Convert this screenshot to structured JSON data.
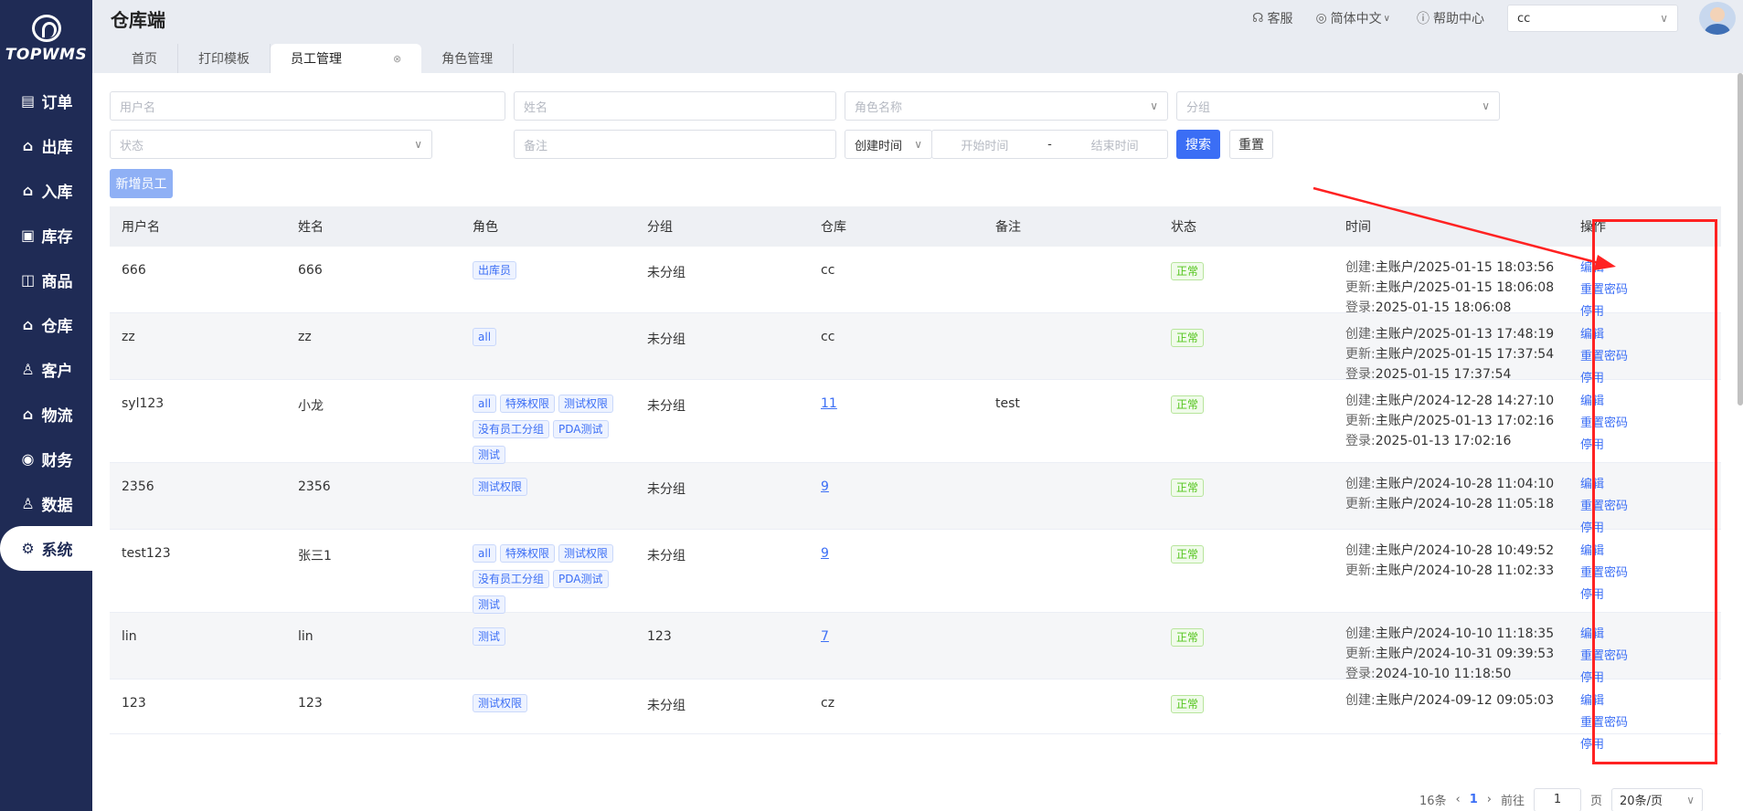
{
  "app": {
    "logo_text": "TOPWMS",
    "page_title": "仓库端"
  },
  "sidebar": {
    "items": [
      {
        "label": "订单",
        "icon": "list-icon",
        "glyph": "▤"
      },
      {
        "label": "出库",
        "icon": "outbound-icon",
        "glyph": "⌂"
      },
      {
        "label": "入库",
        "icon": "inbound-icon",
        "glyph": "⌂"
      },
      {
        "label": "库存",
        "icon": "inventory-icon",
        "glyph": "▣"
      },
      {
        "label": "商品",
        "icon": "goods-icon",
        "glyph": "◫"
      },
      {
        "label": "仓库",
        "icon": "warehouse-icon",
        "glyph": "⌂"
      },
      {
        "label": "客户",
        "icon": "customer-icon",
        "glyph": "♙"
      },
      {
        "label": "物流",
        "icon": "logistics-icon",
        "glyph": "⌂"
      },
      {
        "label": "财务",
        "icon": "finance-icon",
        "glyph": "◉"
      },
      {
        "label": "数据",
        "icon": "data-icon",
        "glyph": "♙"
      },
      {
        "label": "系统",
        "icon": "settings-icon",
        "glyph": "⚙"
      }
    ],
    "active_index": 10
  },
  "header": {
    "service": "客服",
    "language": "简体中文",
    "help": "帮助中心",
    "warehouse_select": "cc"
  },
  "tabs": [
    {
      "label": "首页",
      "active": false
    },
    {
      "label": "打印模板",
      "active": false
    },
    {
      "label": "员工管理",
      "active": true
    },
    {
      "label": "角色管理",
      "active": false
    }
  ],
  "filters": {
    "username_placeholder": "用户名",
    "name_placeholder": "姓名",
    "role_placeholder": "角色名称",
    "group_placeholder": "分组",
    "status_placeholder": "状态",
    "remark_placeholder": "备注",
    "time_type": "创建时间",
    "start_placeholder": "开始时间",
    "range_sep": "-",
    "end_placeholder": "结束时间",
    "search_label": "搜索",
    "reset_label": "重置",
    "add_label": "新增员工"
  },
  "table": {
    "headers": [
      "用户名",
      "姓名",
      "角色",
      "分组",
      "仓库",
      "备注",
      "状态",
      "时间",
      "操作"
    ],
    "time_keys": {
      "created": "创建:",
      "updated": "更新:",
      "login": "登录:"
    },
    "ops": {
      "edit": "编辑",
      "reset_pwd": "重置密码",
      "disable": "停用"
    },
    "rows": [
      {
        "username": "666",
        "name": "666",
        "roles": [
          "出库员"
        ],
        "group": "未分组",
        "warehouse": "cc",
        "warehouse_link": false,
        "remark": "",
        "status": "正常",
        "created": "主账户/2025-01-15 18:03:56",
        "updated": "主账户/2025-01-15 18:06:08",
        "login": "2025-01-15 18:06:08",
        "height": 73
      },
      {
        "username": "zz",
        "name": "zz",
        "roles": [
          "all"
        ],
        "group": "未分组",
        "warehouse": "cc",
        "warehouse_link": false,
        "remark": "",
        "status": "正常",
        "created": "主账户/2025-01-13 17:48:19",
        "updated": "主账户/2025-01-15 17:37:54",
        "login": "2025-01-15 17:37:54",
        "height": 73
      },
      {
        "username": "syl123",
        "name": "小龙",
        "roles": [
          "all",
          "特殊权限",
          "测试权限",
          "没有员工分组",
          "PDA测试",
          "测试"
        ],
        "group": "未分组",
        "warehouse": "11",
        "warehouse_link": true,
        "remark": "test",
        "status": "正常",
        "created": "主账户/2024-12-28 14:27:10",
        "updated": "主账户/2025-01-13 17:02:16",
        "login": "2025-01-13 17:02:16",
        "height": 91
      },
      {
        "username": "2356",
        "name": "2356",
        "roles": [
          "测试权限"
        ],
        "group": "未分组",
        "warehouse": "9",
        "warehouse_link": true,
        "remark": "",
        "status": "正常",
        "created": "主账户/2024-10-28 11:04:10",
        "updated": "主账户/2024-10-28 11:05:18",
        "login": "",
        "height": 73
      },
      {
        "username": "test123",
        "name": "张三1",
        "roles": [
          "all",
          "特殊权限",
          "测试权限",
          "没有员工分组",
          "PDA测试",
          "测试"
        ],
        "group": "未分组",
        "warehouse": "9",
        "warehouse_link": true,
        "remark": "",
        "status": "正常",
        "created": "主账户/2024-10-28 10:49:52",
        "updated": "主账户/2024-10-28 11:02:33",
        "login": "",
        "height": 91
      },
      {
        "username": "lin",
        "name": "lin",
        "roles": [
          "测试"
        ],
        "group": "123",
        "warehouse": "7",
        "warehouse_link": true,
        "remark": "",
        "status": "正常",
        "created": "主账户/2024-10-10 11:18:35",
        "updated": "主账户/2024-10-31 09:39:53",
        "login": "2024-10-10 11:18:50",
        "height": 73
      },
      {
        "username": "123",
        "name": "123",
        "roles": [
          "测试权限"
        ],
        "group": "未分组",
        "warehouse": "cz",
        "warehouse_link": false,
        "remark": "",
        "status": "正常",
        "created": "主账户/2024-09-12 09:05:03",
        "updated": "",
        "login": "",
        "height": 60
      }
    ]
  },
  "pager": {
    "total": "16条",
    "current": "1",
    "goto_label": "前往",
    "goto_value": "1",
    "page_unit": "页",
    "size": "20条/页"
  },
  "annotation": {
    "color": "#ff2222"
  }
}
